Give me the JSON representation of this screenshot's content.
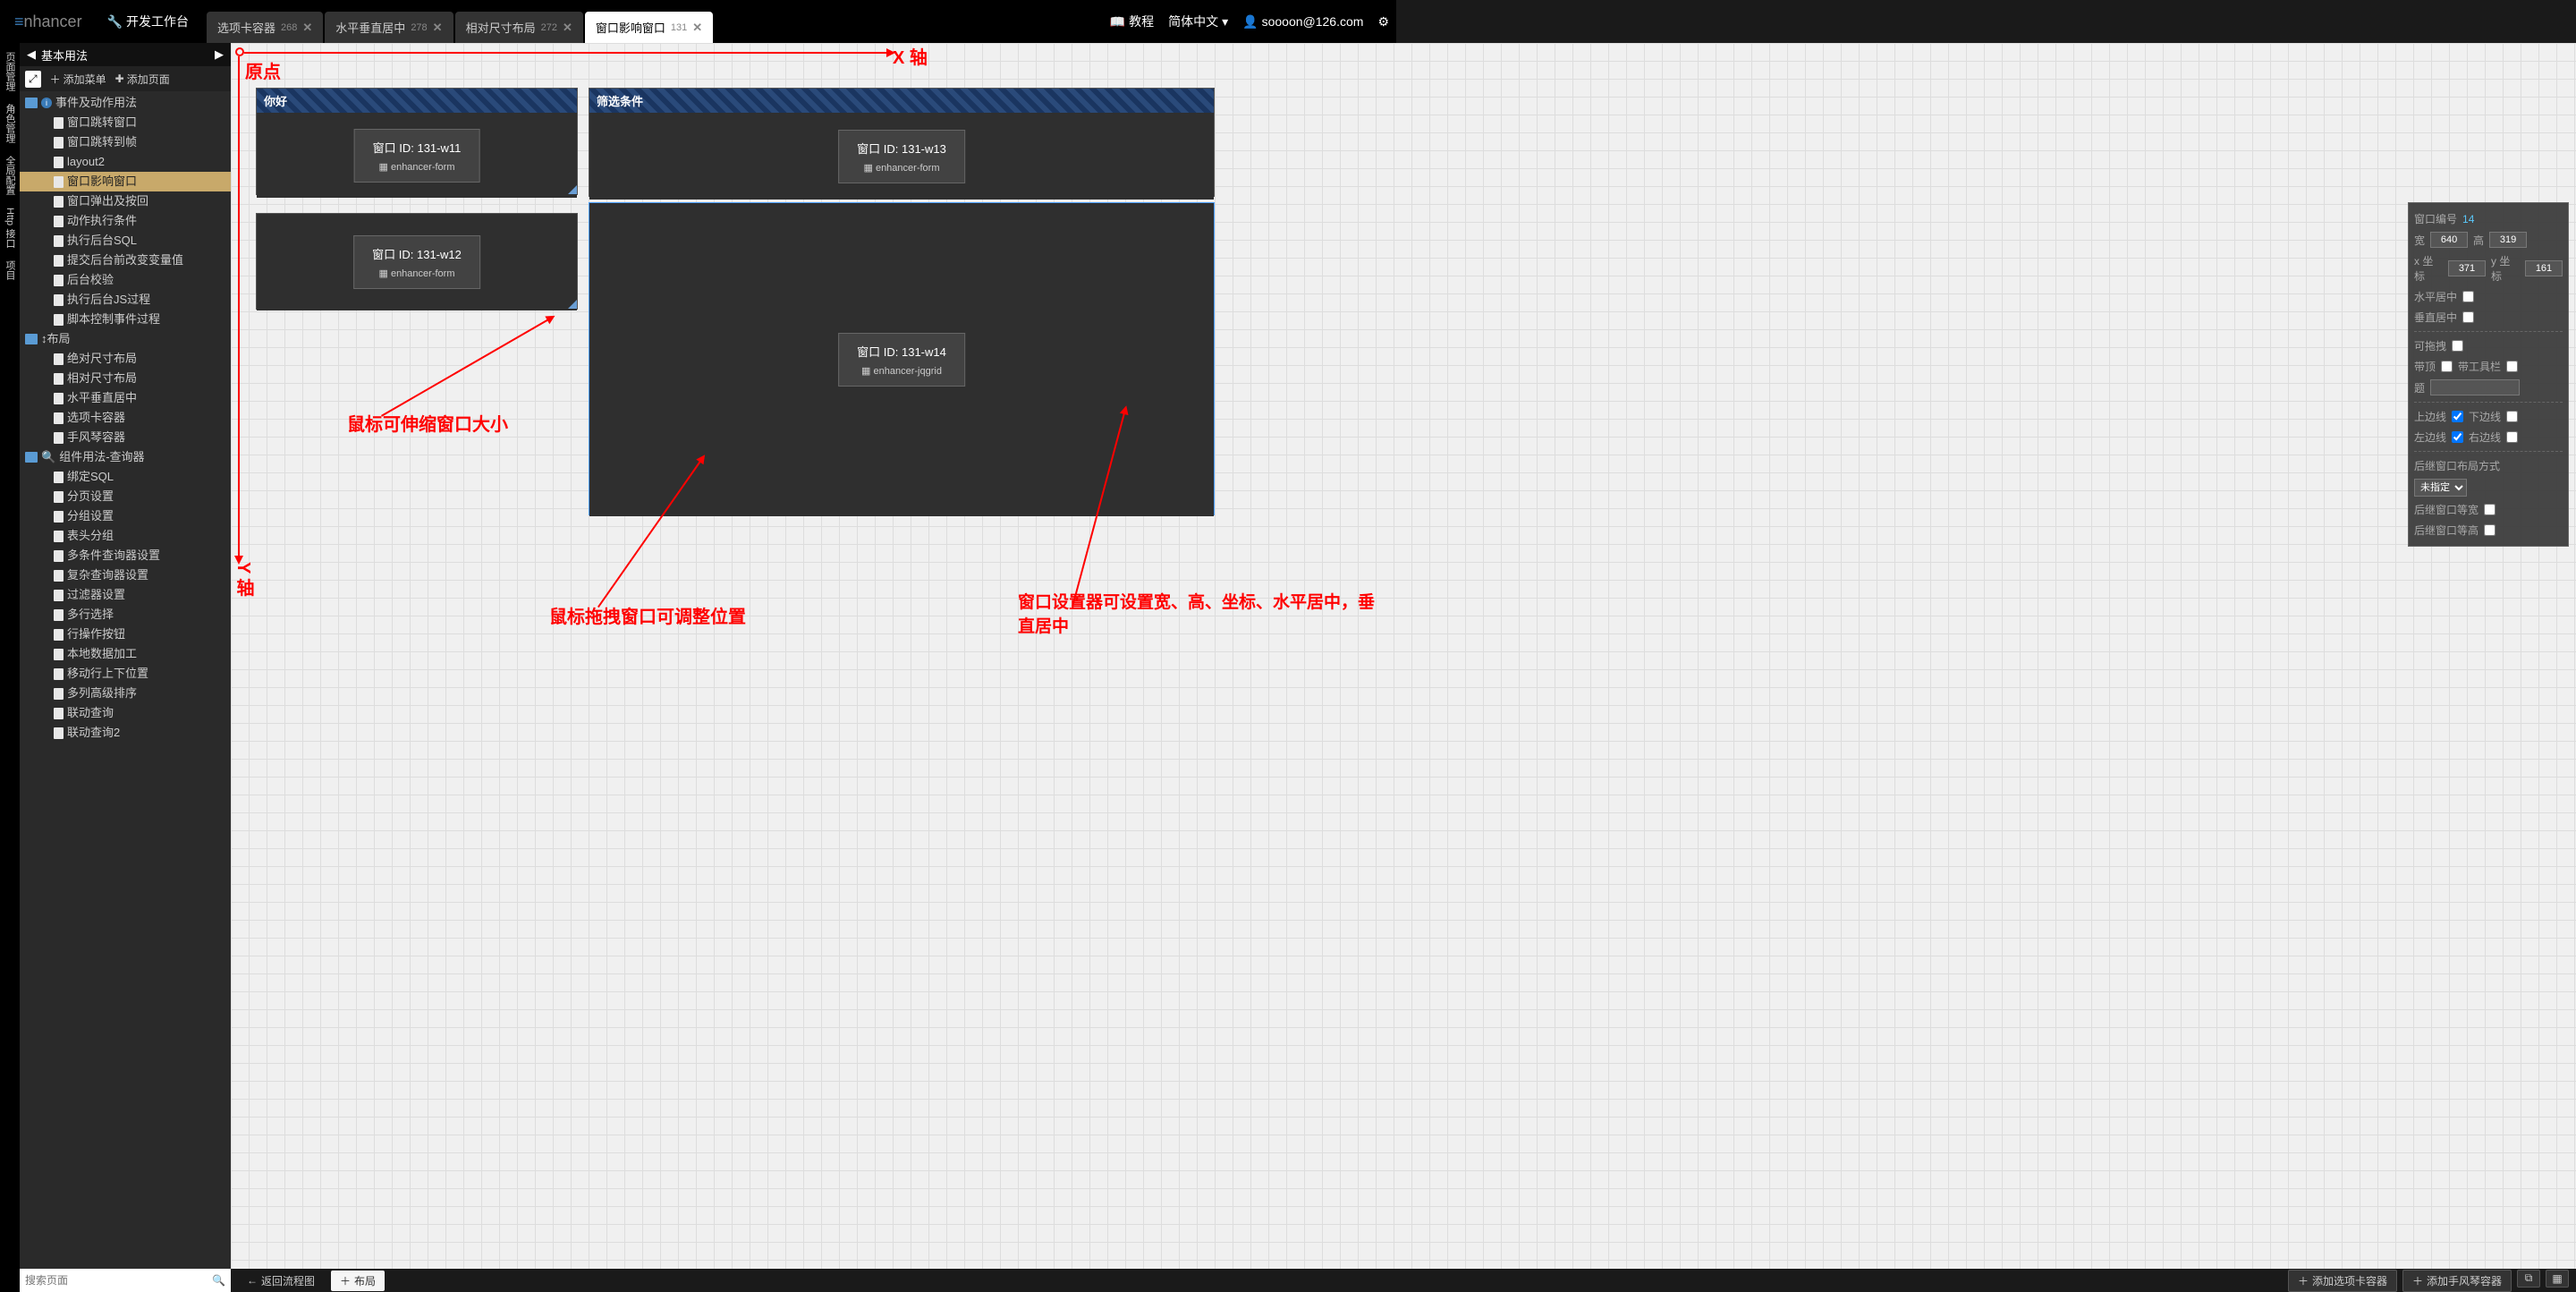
{
  "logo": "nhancer",
  "workspace": "开发工作台",
  "tabs": [
    {
      "label": "选项卡容器",
      "num": "268"
    },
    {
      "label": "水平垂直居中",
      "num": "278"
    },
    {
      "label": "相对尺寸布局",
      "num": "272"
    },
    {
      "label": "窗口影响窗口",
      "num": "131"
    }
  ],
  "nav": {
    "tutorial": "教程",
    "lang": "简体中文",
    "user": "soooon@126.com"
  },
  "rail": [
    "页面管理",
    "角色管理",
    "全局配置",
    "Http 接口",
    "项目"
  ],
  "sidebar": {
    "title": "基本用法",
    "add_menu": "添加菜单",
    "add_page": "添加页面",
    "tree": {
      "g1": {
        "label": "事件及动作用法",
        "items": [
          "窗口跳转窗口",
          "窗口跳转到帧",
          "layout2",
          "窗口影响窗口",
          "窗口弹出及按回",
          "动作执行条件",
          "执行后台SQL",
          "提交后台前改变变量值",
          "后台校验",
          "执行后台JS过程",
          "脚本控制事件过程"
        ]
      },
      "g2": {
        "label": "布局",
        "items": [
          "绝对尺寸布局",
          "相对尺寸布局",
          "水平垂直居中",
          "选项卡容器",
          "手风琴容器"
        ]
      },
      "g3": {
        "label": "组件用法-查询器",
        "items": [
          "绑定SQL",
          "分页设置",
          "分组设置",
          "表头分组",
          "多条件查询器设置",
          "复杂查询器设置",
          "过滤器设置",
          "多行选择",
          "行操作按钮",
          "本地数据加工",
          "移动行上下位置",
          "多列高级排序",
          "联动查询",
          "联动查询2"
        ]
      }
    },
    "search_placeholder": "搜索页面"
  },
  "canvas": {
    "windows": {
      "w11": {
        "title": "你好",
        "id_label": "窗口 ID: 131-w11",
        "component": "enhancer-form"
      },
      "w12": {
        "id_label": "窗口 ID: 131-w12",
        "component": "enhancer-form"
      },
      "w13": {
        "title": "筛选条件",
        "id_label": "窗口 ID: 131-w13",
        "component": "enhancer-form"
      },
      "w14": {
        "id_label": "窗口 ID: 131-w14",
        "component": "enhancer-jqgrid"
      }
    },
    "anno": {
      "origin": "原点",
      "x_axis": "X 轴",
      "y_axis": "Y 轴",
      "resize": "鼠标可伸缩窗口大小",
      "drag": "鼠标拖拽窗口可调整位置",
      "prop": "窗口设置器可设置宽、高、坐标、水平居中，垂直居中"
    }
  },
  "props": {
    "id_label": "窗口编号",
    "id_val": "14",
    "w_label": "宽",
    "w_val": "640",
    "h_label": "高",
    "h_val": "319",
    "x_label": "x 坐标",
    "x_val": "371",
    "y_label": "y 坐标",
    "y_val": "161",
    "hcenter": "水平居中",
    "vcenter": "垂直居中",
    "draggable": "可拖拽",
    "bring_top": "带顶",
    "toolbar": "带工具栏",
    "title": "题",
    "border_t": "上边线",
    "border_b": "下边线",
    "border_l": "左边线",
    "border_r": "右边线",
    "succ_layout": "后继窗口布局方式",
    "succ_opt": "未指定",
    "succ_w": "后继窗口等宽",
    "succ_h": "后继窗口等高"
  },
  "bottom": {
    "back": "返回流程图",
    "layout": "布局",
    "add_tab": "添加选项卡容器",
    "add_acc": "添加手风琴容器"
  }
}
